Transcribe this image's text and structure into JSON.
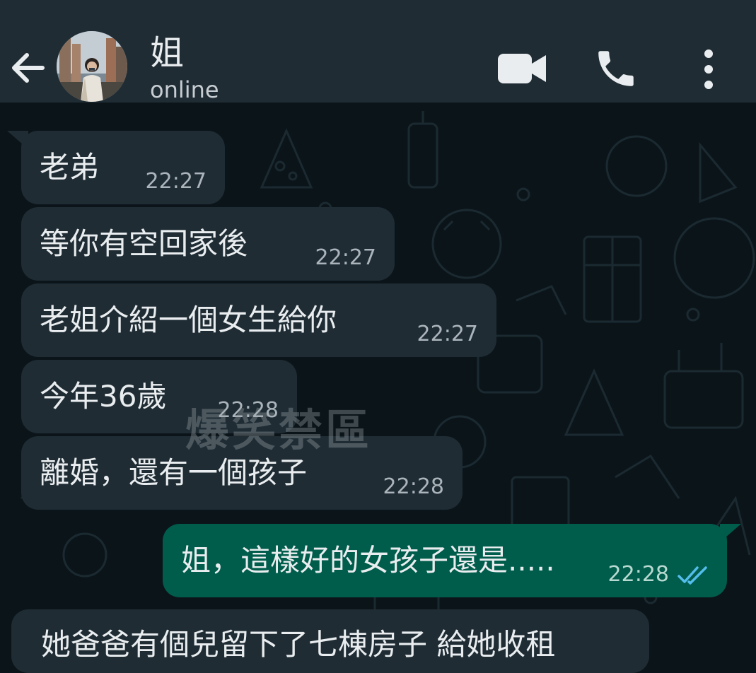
{
  "header": {
    "back_icon": "arrow-left-icon",
    "contact_name": "姐",
    "status": "online",
    "video_icon": "video-camera-icon",
    "call_icon": "phone-icon",
    "menu_icon": "more-vertical-icon"
  },
  "messages": [
    {
      "direction": "in",
      "text": "老弟",
      "time": "22:27"
    },
    {
      "direction": "in",
      "text": "等你有空回家後",
      "time": "22:27"
    },
    {
      "direction": "in",
      "text": "老姐介紹一個女生給你",
      "time": "22:27"
    },
    {
      "direction": "in",
      "text": "今年36歲",
      "time": "22:28"
    },
    {
      "direction": "in",
      "text": "離婚，還有一個孩子",
      "time": "22:28"
    },
    {
      "direction": "out",
      "text": "姐，這樣好的女孩子還是.....",
      "time": "22:28",
      "status_icon": "double-check-read-icon"
    },
    {
      "direction": "in",
      "text": "她爸爸有個兒留下了七棟房子 給她收租"
    }
  ],
  "watermark": "爆笑禁區",
  "colors": {
    "header_bg": "#1f2c34",
    "chat_bg": "#0b1419",
    "incoming_bubble": "#1f2c34",
    "outgoing_bubble": "#005c4b",
    "read_ticks": "#53bdeb"
  }
}
